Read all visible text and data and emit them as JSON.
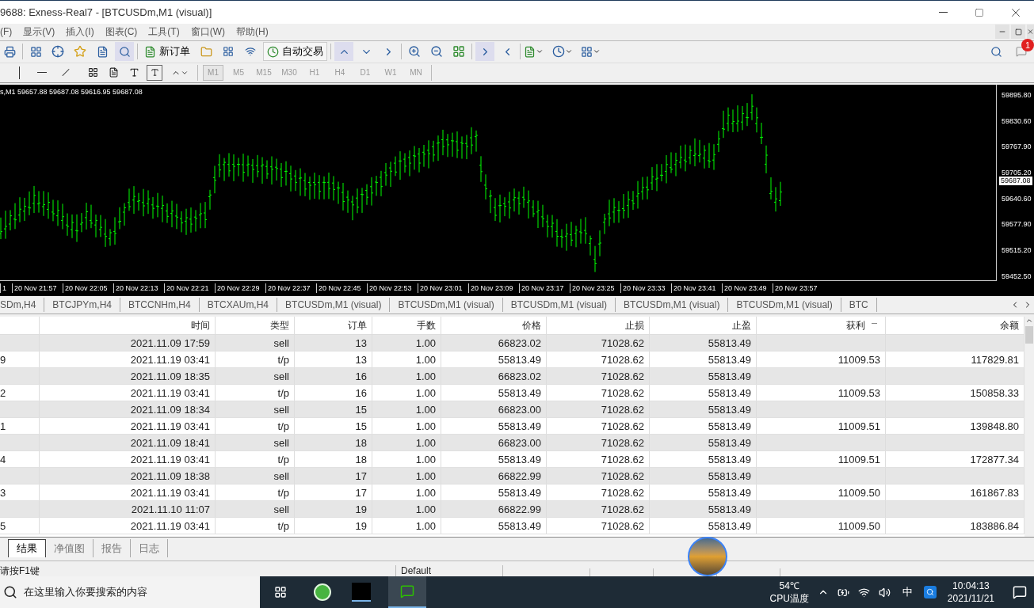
{
  "window": {
    "title": "9688: Exness-Real7 - [BTCUSDm,M1 (visual)]"
  },
  "menu": [
    "(F)",
    "显示(V)",
    "插入(I)",
    "图表(C)",
    "工具(T)",
    "窗口(W)",
    "帮助(H)"
  ],
  "toolbar": {
    "new_order": "新订单",
    "auto_trading": "自动交易",
    "notification_badge": "1"
  },
  "timeframes": [
    {
      "label": "M1",
      "selected": true
    },
    {
      "label": "M5",
      "selected": false
    },
    {
      "label": "M15",
      "selected": false
    },
    {
      "label": "M30",
      "selected": false
    },
    {
      "label": "H1",
      "selected": false
    },
    {
      "label": "H4",
      "selected": false
    },
    {
      "label": "D1",
      "selected": false
    },
    {
      "label": "W1",
      "selected": false
    },
    {
      "label": "MN",
      "selected": false
    }
  ],
  "chart": {
    "header": "s,M1  59657.88 59687.08 59616.95 59687.08",
    "current_price": "59687.08",
    "price_labels": [
      "59895.80",
      "59830.60",
      "59767.90",
      "59705.20",
      "59640.60",
      "59577.90",
      "59515.20",
      "59452.50"
    ],
    "time_labels": [
      "1",
      "20 Nov 21:57",
      "20 Nov 22:05",
      "20 Nov 22:13",
      "20 Nov 22:21",
      "20 Nov 22:29",
      "20 Nov 22:37",
      "20 Nov 22:45",
      "20 Nov 22:53",
      "20 Nov 23:01",
      "20 Nov 23:09",
      "20 Nov 23:17",
      "20 Nov 23:25",
      "20 Nov 23:33",
      "20 Nov 23:41",
      "20 Nov 23:49",
      "20 Nov 23:57"
    ]
  },
  "chart_tabs": [
    "SDm,H4",
    "BTCJPYm,H4",
    "BTCCNHm,H4",
    "BTCXAUm,H4",
    "BTCUSDm,M1 (visual)",
    "BTCUSDm,M1 (visual)",
    "BTCUSDm,M1 (visual)",
    "BTCUSDm,M1 (visual)",
    "BTCUSDm,M1 (visual)",
    "BTC"
  ],
  "table": {
    "columns": [
      {
        "label": "时间",
        "sorted": false
      },
      {
        "label": "类型",
        "sorted": false
      },
      {
        "label": "订单",
        "sorted": false
      },
      {
        "label": "手数",
        "sorted": false
      },
      {
        "label": "价格",
        "sorted": false
      },
      {
        "label": "止损",
        "sorted": false
      },
      {
        "label": "止盈",
        "sorted": false
      },
      {
        "label": "获利",
        "sorted": true
      },
      {
        "label": "余额",
        "sorted": false
      }
    ],
    "rows": [
      {
        "time": "2021.11.09 17:59",
        "type": "sell",
        "order": "13",
        "lots": "1.00",
        "price": "66823.02",
        "sl": "71028.62",
        "tp": "55813.49"
      },
      {
        "column_1": "9",
        "time": "2021.11.19 03:41",
        "type": "t/p",
        "order": "13",
        "lots": "1.00",
        "price": "55813.49",
        "sl": "71028.62",
        "tp": "55813.49",
        "profit": "11009.53",
        "balance": "117829.81"
      },
      {
        "time": "2021.11.09 18:35",
        "type": "sell",
        "order": "16",
        "lots": "1.00",
        "price": "66823.02",
        "sl": "71028.62",
        "tp": "55813.49"
      },
      {
        "column_1": "2",
        "time": "2021.11.19 03:41",
        "type": "t/p",
        "order": "16",
        "lots": "1.00",
        "price": "55813.49",
        "sl": "71028.62",
        "tp": "55813.49",
        "profit": "11009.53",
        "balance": "150858.33"
      },
      {
        "time": "2021.11.09 18:34",
        "type": "sell",
        "order": "15",
        "lots": "1.00",
        "price": "66823.00",
        "sl": "71028.62",
        "tp": "55813.49"
      },
      {
        "column_1": "1",
        "time": "2021.11.19 03:41",
        "type": "t/p",
        "order": "15",
        "lots": "1.00",
        "price": "55813.49",
        "sl": "71028.62",
        "tp": "55813.49",
        "profit": "11009.51",
        "balance": "139848.80"
      },
      {
        "time": "2021.11.09 18:41",
        "type": "sell",
        "order": "18",
        "lots": "1.00",
        "price": "66823.00",
        "sl": "71028.62",
        "tp": "55813.49"
      },
      {
        "column_1": "4",
        "time": "2021.11.19 03:41",
        "type": "t/p",
        "order": "18",
        "lots": "1.00",
        "price": "55813.49",
        "sl": "71028.62",
        "tp": "55813.49",
        "profit": "11009.51",
        "balance": "172877.34"
      },
      {
        "time": "2021.11.09 18:38",
        "type": "sell",
        "order": "17",
        "lots": "1.00",
        "price": "66822.99",
        "sl": "71028.62",
        "tp": "55813.49"
      },
      {
        "column_1": "3",
        "time": "2021.11.19 03:41",
        "type": "t/p",
        "order": "17",
        "lots": "1.00",
        "price": "55813.49",
        "sl": "71028.62",
        "tp": "55813.49",
        "profit": "11009.50",
        "balance": "161867.83"
      },
      {
        "time": "2021.11.10 11:07",
        "type": "sell",
        "order": "19",
        "lots": "1.00",
        "price": "66822.99",
        "sl": "71028.62",
        "tp": "55813.49"
      },
      {
        "column_1": "5",
        "time": "2021.11.19 03:41",
        "type": "t/p",
        "order": "19",
        "lots": "1.00",
        "price": "55813.49",
        "sl": "71028.62",
        "tp": "55813.49",
        "profit": "11009.50",
        "balance": "183886.84"
      }
    ]
  },
  "bottom_tabs": [
    {
      "label": "结果",
      "selected": true
    },
    {
      "label": "净值图",
      "selected": false
    },
    {
      "label": "报告",
      "selected": false
    },
    {
      "label": "日志",
      "selected": false
    }
  ],
  "status_bar": [
    "请按F1键",
    "Default"
  ],
  "taskbar": {
    "search_placeholder": "在这里输入你要搜索的内容",
    "temperature": "54℃",
    "temperature_label": "CPU温度",
    "input_method": "中",
    "time": "10:04:13",
    "date": "2021/11/21"
  }
}
